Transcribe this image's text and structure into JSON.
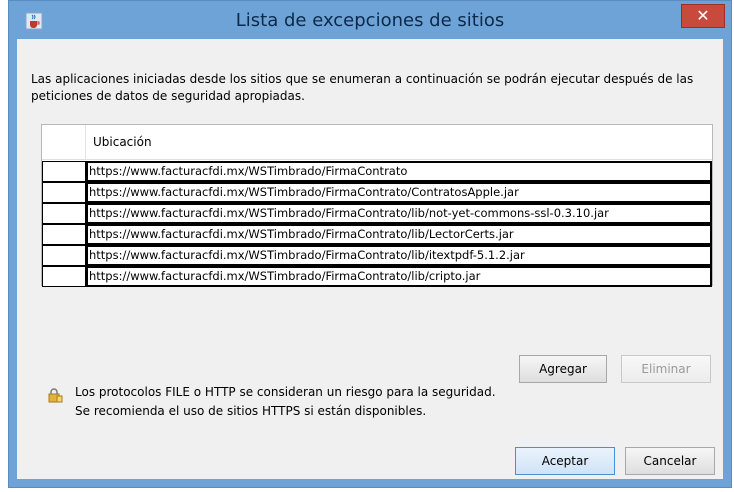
{
  "window": {
    "title": "Lista de excepciones de sitios",
    "close_label": "✕"
  },
  "description": "Las aplicaciones iniciadas desde los sitios que se enumeran a continuación se podrán ejecutar después de las peticiones de datos de seguridad apropiadas.",
  "table": {
    "header": "Ubicación",
    "rows": [
      "https://www.facturacfdi.mx/WSTimbrado/FirmaContrato",
      "https://www.facturacfdi.mx/WSTimbrado/FirmaContrato/ContratosApple.jar",
      "https://www.facturacfdi.mx/WSTimbrado/FirmaContrato/lib/not-yet-commons-ssl-0.3.10.jar",
      "https://www.facturacfdi.mx/WSTimbrado/FirmaContrato/lib/LectorCerts.jar",
      "https://www.facturacfdi.mx/WSTimbrado/FirmaContrato/lib/itextpdf-5.1.2.jar",
      "https://www.facturacfdi.mx/WSTimbrado/FirmaContrato/lib/cripto.jar"
    ]
  },
  "buttons": {
    "add": "Agregar",
    "remove": "Eliminar",
    "accept": "Aceptar",
    "cancel": "Cancelar"
  },
  "warning": {
    "line1": "Los protocolos FILE o HTTP se consideran un riesgo para la seguridad.",
    "line2": "Se recomienda el uso de sitios HTTPS si están disponibles."
  },
  "icons": {
    "app": "java-cup-icon",
    "lock": "lock-warning-icon"
  }
}
